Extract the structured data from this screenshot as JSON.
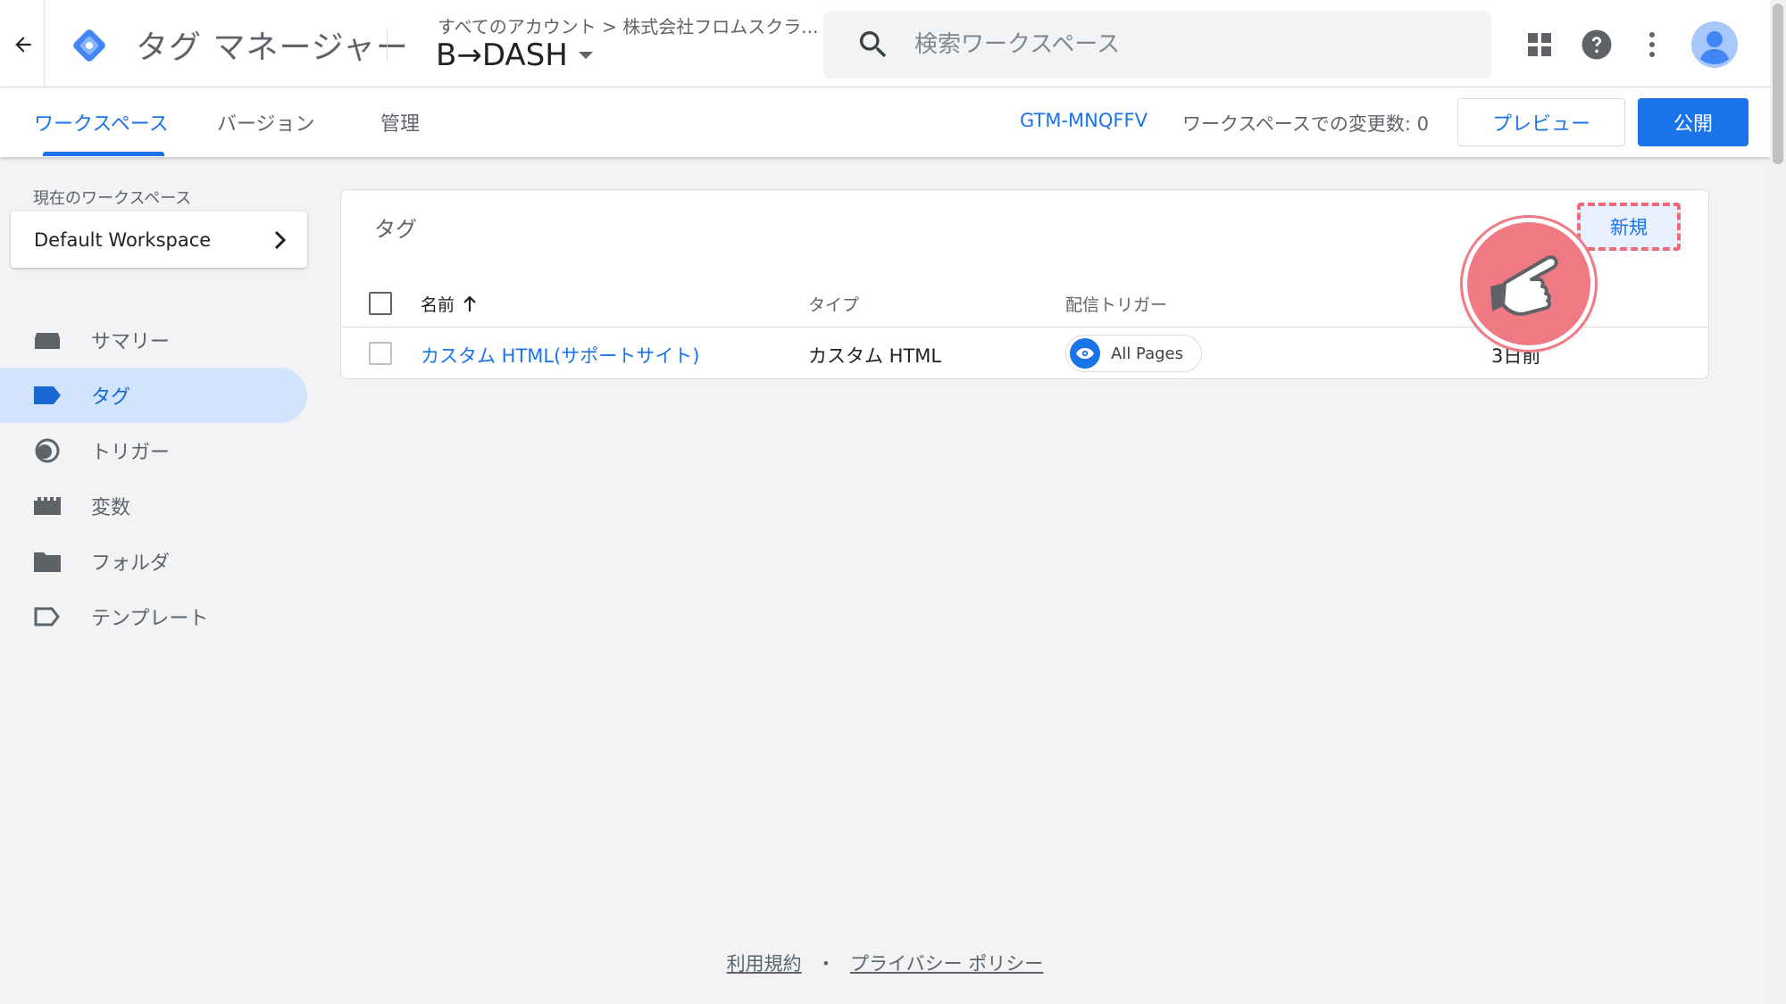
{
  "app": {
    "product_name": "タグ マネージャー",
    "breadcrumb": "すべてのアカウント > 株式会社フロムスクラ...",
    "account_title": "B→DASH"
  },
  "search": {
    "placeholder": "検索ワークスペース"
  },
  "icons": {
    "back": "arrow-back-icon",
    "logo": "tag-manager-logo",
    "search": "search-icon",
    "apps": "apps-grid-icon",
    "help": "help-icon",
    "more": "more-vert-icon",
    "avatar": "account-avatar-icon"
  },
  "tabs": [
    {
      "label": "ワークスペース",
      "active": true
    },
    {
      "label": "バージョン",
      "active": false
    },
    {
      "label": "管理",
      "active": false
    }
  ],
  "toolbar": {
    "container_id": "GTM-MNQFFV",
    "change_count": "ワークスペースでの変更数: 0",
    "preview_label": "プレビュー",
    "publish_label": "公開"
  },
  "sidebar": {
    "workspace_label": "現在のワークスペース",
    "workspace_name": "Default Workspace",
    "items": [
      {
        "label": "サマリー",
        "icon": "summary-icon",
        "active": false
      },
      {
        "label": "タグ",
        "icon": "tag-icon",
        "active": true
      },
      {
        "label": "トリガー",
        "icon": "trigger-icon",
        "active": false
      },
      {
        "label": "変数",
        "icon": "variables-icon",
        "active": false
      },
      {
        "label": "フォルダ",
        "icon": "folder-icon",
        "active": false
      },
      {
        "label": "テンプレート",
        "icon": "template-icon",
        "active": false
      }
    ]
  },
  "tags_card": {
    "title": "タグ",
    "new_label": "新規",
    "columns": {
      "name": "名前",
      "type": "タイプ",
      "trigger": "配信トリガー"
    },
    "rows": [
      {
        "name": "カスタム HTML(サポートサイト)",
        "type": "カスタム HTML",
        "trigger": "All Pages",
        "last_edited": "3日前"
      }
    ]
  },
  "footer": {
    "terms": "利用規約",
    "separator": "・",
    "privacy": "プライバシー ポリシー"
  },
  "colors": {
    "accent": "#1a73e8",
    "active_nav_bg": "#d2e3fc",
    "highlight": "#f07a84"
  }
}
